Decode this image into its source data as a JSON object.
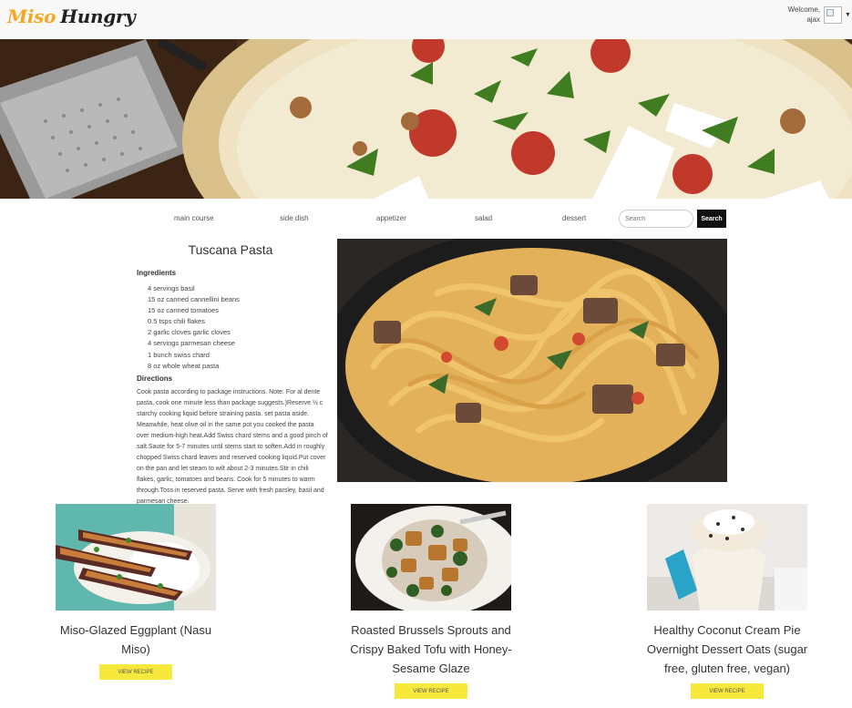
{
  "header": {
    "logo_part1": "Miso",
    "logo_part2": "Hungry",
    "welcome_line1": "Welcome,",
    "welcome_line2": "ajax",
    "caret": "▼"
  },
  "nav": {
    "items": [
      "main course",
      "side dish",
      "appetizer",
      "salad",
      "dessert"
    ],
    "search_placeholder": "Search",
    "search_label": "Search"
  },
  "recipe": {
    "title": "Tuscana Pasta",
    "ingredients_label": "Ingredients",
    "ingredients": [
      "4 servings basil",
      "15 oz canned cannellini beans",
      "15 oz canned tomatoes",
      "0.5 tsps chili flakes",
      "2 garlic cloves garlic cloves",
      "4 servings parmesan cheese",
      "1 bunch swiss chard",
      "8 oz whole wheat pasta"
    ],
    "directions_label": "Directions",
    "directions": "Cook pasta according to package instructions. Note: For al dente pasta, cook one minute less than package suggests.)Reserve ½ c starchy cooking liquid before straining pasta. set pasta aside. Meanwhile, heat olive oil in the same pot you cooked the pasta over medium-high heat.Add Swiss chard stems and a good pinch of salt.Saute for 5-7 minutes until stems start to soften.Add in roughly chopped Swiss chard leaves and reserved cooking liquid.Put cover on the pan and let steam to wilt about 2-3 minutes.Stir in chili flakes, garlic, tomatoes and beans. Cook for 5 minutes to warm through.Toss in reserved pasta. Serve with fresh parsley, basil and parmesan cheese."
  },
  "cards": [
    {
      "title": "Miso-Glazed Eggplant (Nasu Miso)",
      "button": "VIEW RECIPE"
    },
    {
      "title": "Roasted Brussels Sprouts and Crispy Baked Tofu with Honey-Sesame Glaze",
      "button": "VIEW RECIPE"
    },
    {
      "title": "Healthy Coconut Cream Pie Overnight Dessert Oats (sugar free, gluten free, vegan)",
      "button": "VIEW RECIPE"
    }
  ]
}
